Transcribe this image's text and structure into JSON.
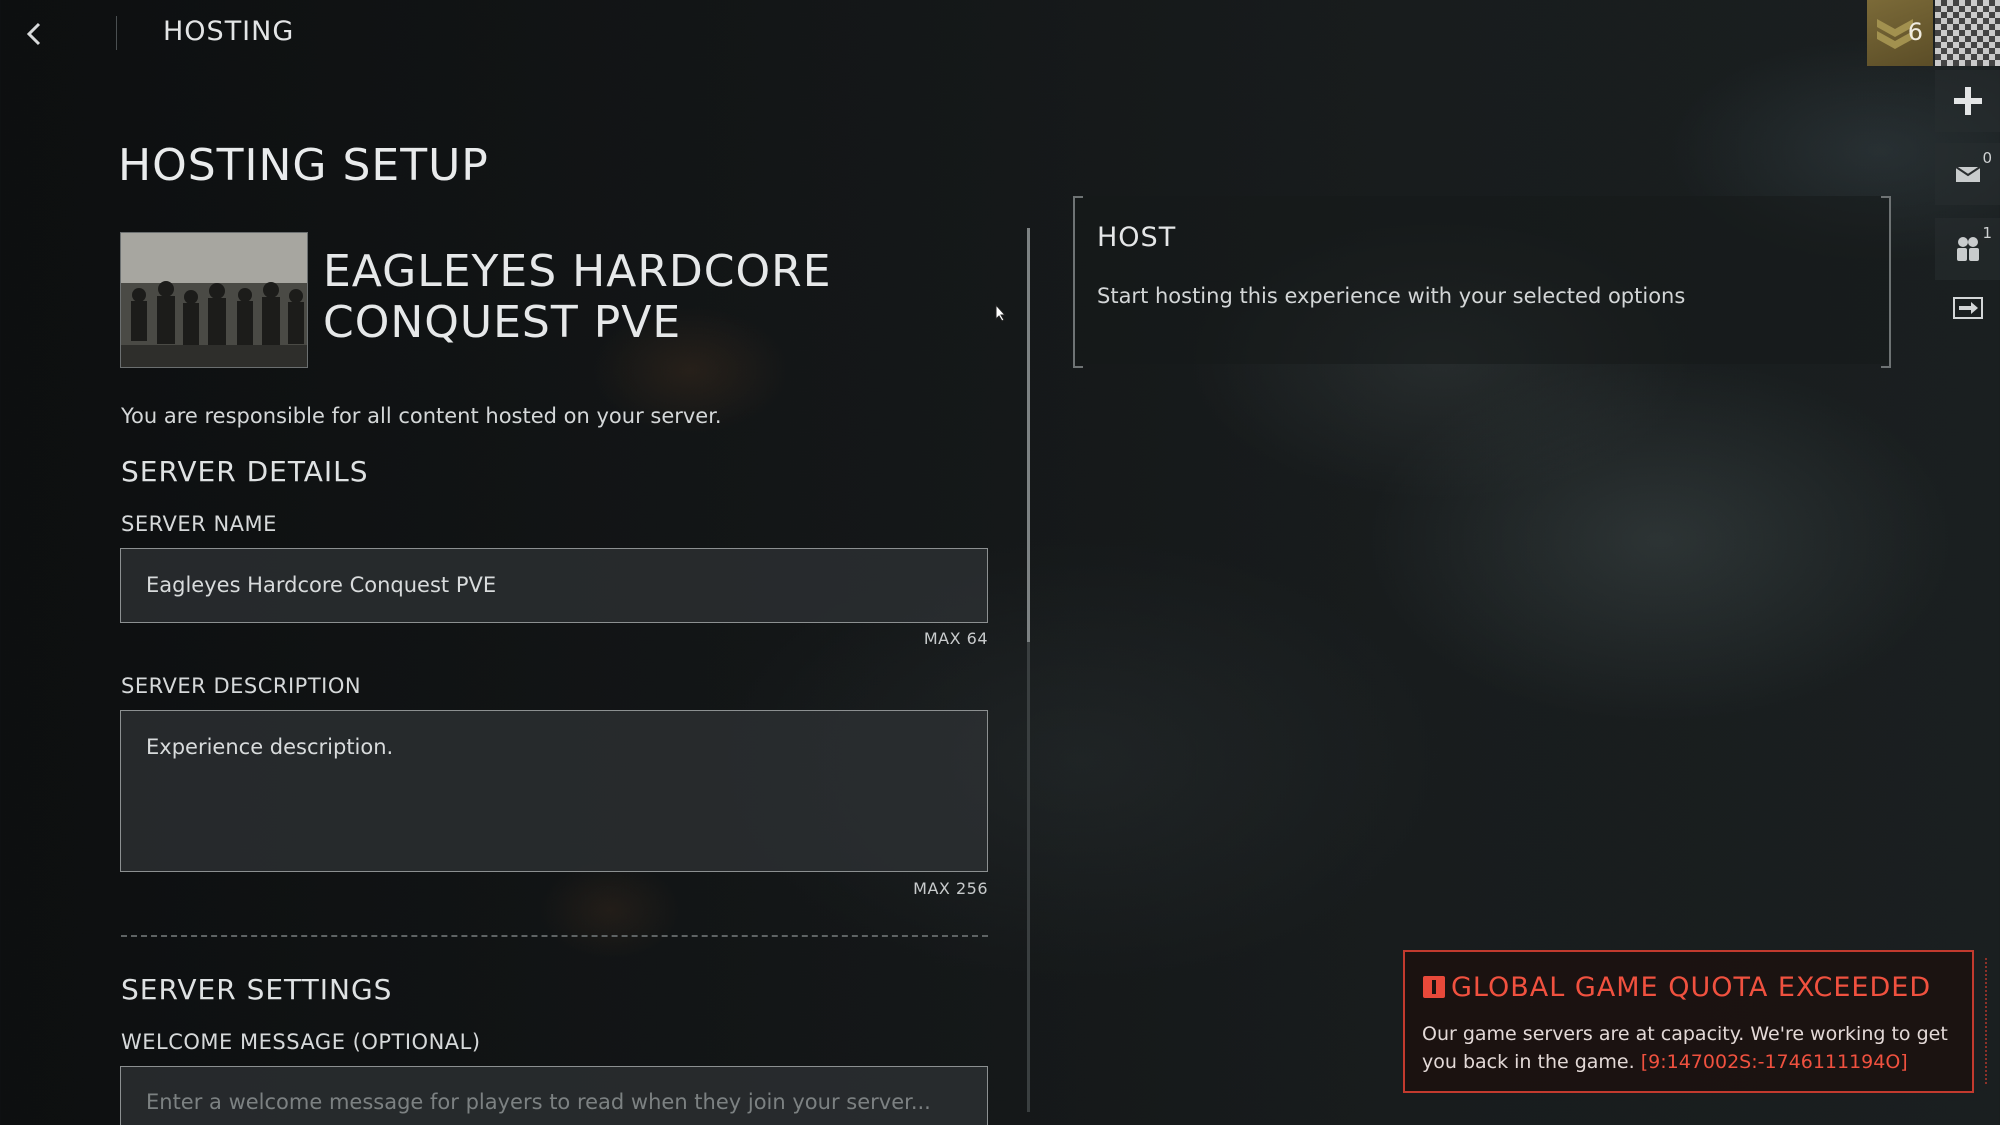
{
  "topbar": {
    "title": "HOSTING",
    "back_icon": "chevron-left-icon"
  },
  "profile": {
    "rank": "6"
  },
  "rail": {
    "add_icon": "plus-icon",
    "messages": {
      "icon": "envelope-icon",
      "count": "0"
    },
    "squad": {
      "icon": "players-icon",
      "count": "1"
    },
    "exit_icon": "exit-icon"
  },
  "page": {
    "title": "HOSTING SETUP"
  },
  "experience": {
    "title": "EAGLEYES HARDCORE CONQUEST PVE"
  },
  "disclaimer": "You are responsible for all content hosted on your server.",
  "server_details": {
    "heading": "SERVER DETAILS",
    "name_label": "SERVER NAME",
    "name_value": "Eagleyes Hardcore Conquest PVE",
    "name_max": "MAX 64",
    "description_label": "SERVER DESCRIPTION",
    "description_value": "Experience description.",
    "description_max": "MAX 256"
  },
  "server_settings": {
    "heading": "SERVER SETTINGS",
    "welcome_label": "WELCOME MESSAGE (OPTIONAL)",
    "welcome_placeholder": "Enter a welcome message for players to read when they join your server..."
  },
  "host_card": {
    "title": "HOST",
    "description": "Start hosting this experience with your selected options"
  },
  "toast": {
    "icon": "alert-icon",
    "title": "GLOBAL GAME QUOTA EXCEEDED",
    "message": "Our game servers are at capacity. We're working to get you back in the game.",
    "code": "[9:147002S:-1746111194O]"
  },
  "colors": {
    "accent_error": "#f0513f",
    "error_border": "#c23a2e",
    "rank_badge": "#7b6a38"
  }
}
